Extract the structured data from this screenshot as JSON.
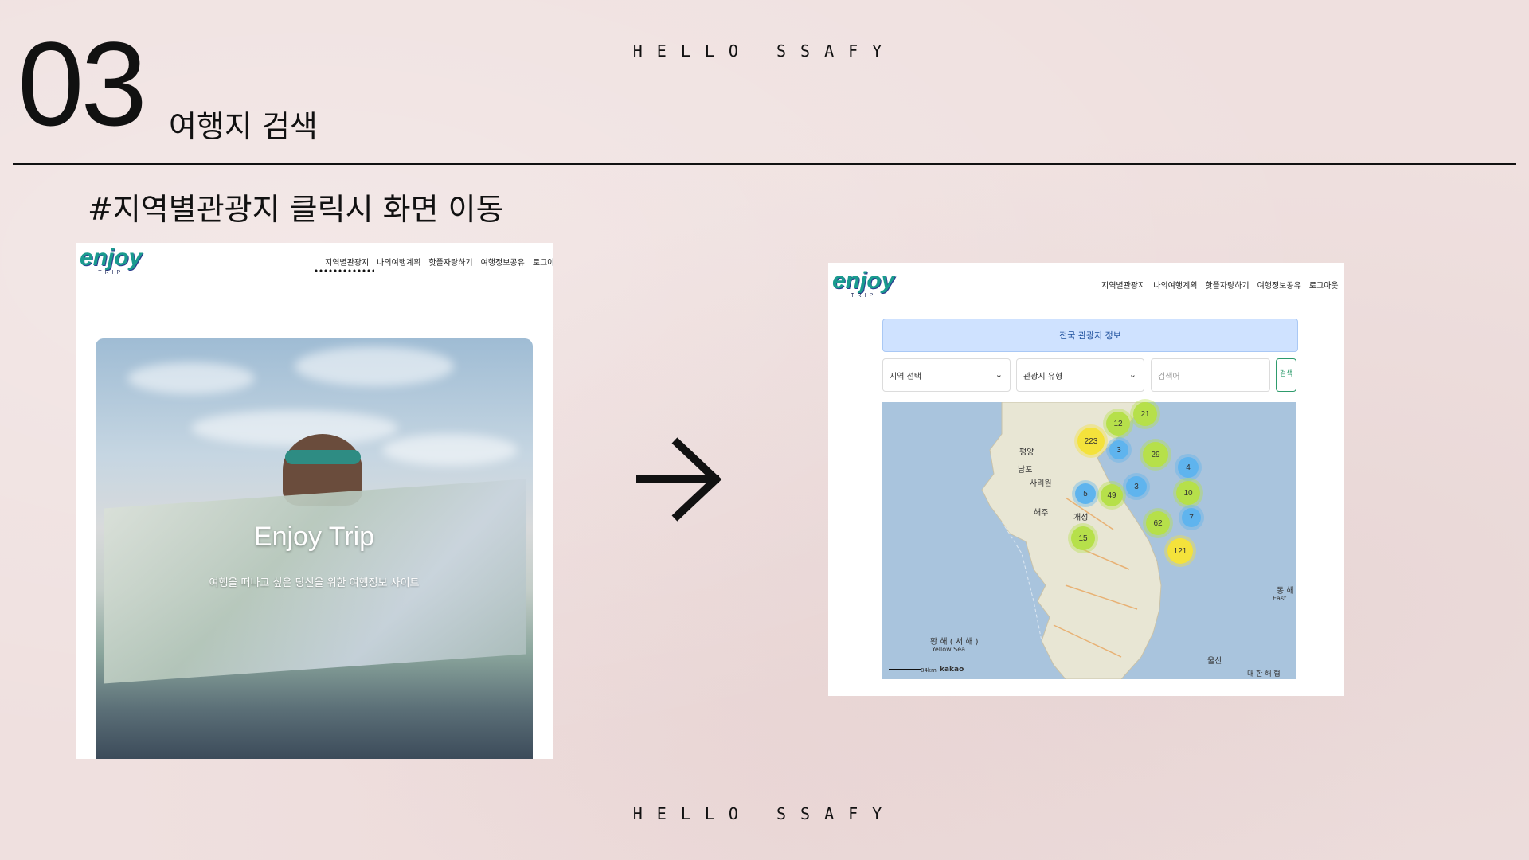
{
  "slide": {
    "header": "HELLO SSAFY",
    "footer": "HELLO SSAFY",
    "section_number": "03",
    "section_title": "여행지 검색",
    "subheading": "#지역별관광지 클릭시 화면 이동"
  },
  "left_screen": {
    "logo": {
      "word": "enjoy",
      "sub": "TRIP"
    },
    "nav": [
      "지역별관광지",
      "나의여행계획",
      "핫플자랑하기",
      "여행정보공유",
      "로그아웃"
    ],
    "active_nav": "지역별관광지",
    "hero": {
      "title": "Enjoy Trip",
      "subtitle": "여행을 떠나고 싶은 당신을 위한 여행정보 사이트"
    }
  },
  "right_screen": {
    "logo": {
      "word": "enjoy",
      "sub": "TRIP"
    },
    "nav": [
      "지역별관광지",
      "나의여행계획",
      "핫플자랑하기",
      "여행정보공유",
      "로그아웃"
    ],
    "banner": "전국 관광지 정보",
    "region_select": "지역 선택",
    "type_select": "관광지 유형",
    "search_placeholder": "검색어",
    "search_button": "검색",
    "map": {
      "labels": [
        "평양",
        "남포",
        "사리원",
        "해주",
        "개성",
        "울산",
        "황 해 ( 서 해 )",
        "Yellow Sea",
        "동 해",
        "East",
        "대 한 해 협",
        "kakao",
        "84km"
      ],
      "clusters": [
        {
          "count": "21",
          "color": "#b6e04a"
        },
        {
          "count": "12",
          "color": "#b6e04a"
        },
        {
          "count": "223",
          "color": "#f4e23b"
        },
        {
          "count": "3",
          "color": "#5fb4ee"
        },
        {
          "count": "29",
          "color": "#b6e04a"
        },
        {
          "count": "4",
          "color": "#5fb4ee"
        },
        {
          "count": "3",
          "color": "#5fb4ee"
        },
        {
          "count": "10",
          "color": "#b6e04a"
        },
        {
          "count": "5",
          "color": "#5fb4ee"
        },
        {
          "count": "49",
          "color": "#b6e04a"
        },
        {
          "count": "62",
          "color": "#b6e04a"
        },
        {
          "count": "7",
          "color": "#5fb4ee"
        },
        {
          "count": "15",
          "color": "#b6e04a"
        },
        {
          "count": "121",
          "color": "#f4e23b"
        }
      ]
    }
  }
}
